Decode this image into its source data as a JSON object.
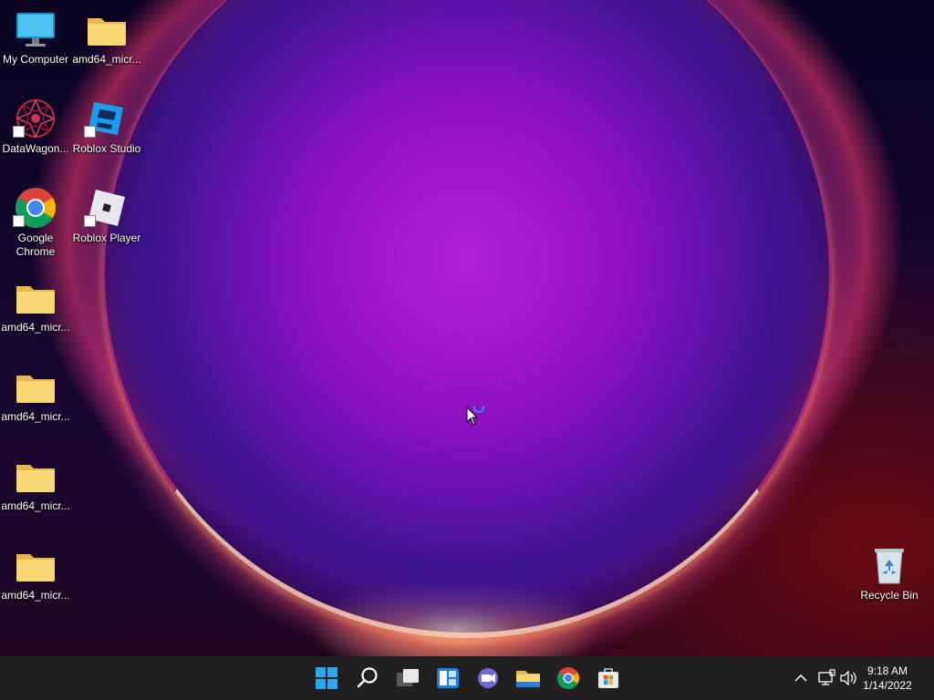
{
  "desktop": {
    "icons": [
      {
        "label": "My Computer",
        "icon": "monitor-icon"
      },
      {
        "label": "amd64_micr...",
        "icon": "folder-icon"
      },
      {
        "label": "DataWagon...",
        "icon": "datawagon-icon"
      },
      {
        "label": "Roblox Studio",
        "icon": "roblox-studio-icon"
      },
      {
        "label": "Google Chrome",
        "icon": "chrome-icon"
      },
      {
        "label": "Roblox Player",
        "icon": "roblox-player-icon"
      },
      {
        "label": "amd64_micr...",
        "icon": "folder-icon"
      },
      {
        "label": "amd64_micr...",
        "icon": "folder-icon"
      },
      {
        "label": "amd64_micr...",
        "icon": "folder-icon"
      },
      {
        "label": "amd64_micr...",
        "icon": "folder-icon"
      },
      {
        "label": "Recycle Bin",
        "icon": "recycle-bin-icon"
      }
    ]
  },
  "taskbar": {
    "pinned": [
      "start-icon",
      "search-icon",
      "task-view-icon",
      "widgets-icon",
      "chat-icon",
      "file-explorer-icon",
      "chrome-icon",
      "store-icon"
    ],
    "tray": {
      "icons": [
        "chevron-up-icon",
        "network-icon",
        "volume-icon"
      ],
      "time": "9:18 AM",
      "date": "1/14/2022"
    }
  },
  "colors": {
    "taskbar_bg": "#202020",
    "folder_yellow": "#f8d775",
    "accent_blue": "#0078d4"
  }
}
